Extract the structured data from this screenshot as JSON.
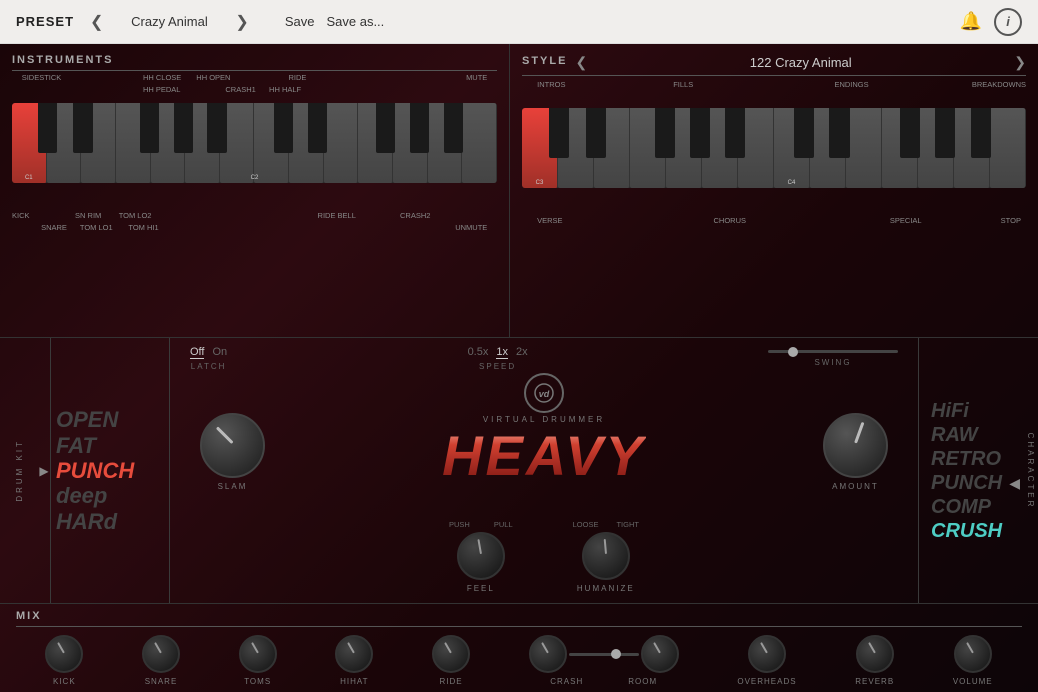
{
  "header": {
    "preset_label": "PRESET",
    "preset_name": "Crazy Animal",
    "save_label": "Save",
    "save_as_label": "Save as...",
    "prev_icon": "❮",
    "next_icon": "❯",
    "bell_icon": "🔔",
    "info_icon": "i"
  },
  "instruments": {
    "title": "INSTRUMENTS",
    "labels_top": [
      "SIDESTICK",
      "HH CLOSE",
      "HH OPEN",
      "RIDE",
      "MUTE"
    ],
    "labels_top2": [
      "",
      "HH PEDAL",
      "",
      "CRASH1",
      "HH HALF"
    ],
    "labels_bottom": [
      "KICK",
      "SN RIM",
      "TOM LO2",
      "RIDE BELL",
      "CRASH2"
    ],
    "labels_bottom2": [
      "",
      "SNARE",
      "TOM LO1",
      "TOM HI1",
      "",
      "UNMUTE"
    ],
    "note_c1": "C1",
    "note_c2": "C2"
  },
  "style": {
    "title": "STYLE",
    "name": "122 Crazy Animal",
    "prev_icon": "❮",
    "next_icon": "❯",
    "labels_top": [
      "INTROS",
      "FILLS",
      "ENDINGS",
      "BREAKDOWNS"
    ],
    "labels_bottom": [
      "VERSE",
      "",
      "CHORUS",
      "",
      "SPECIAL",
      "STOP"
    ],
    "note_c3": "C3",
    "note_c4": "C4"
  },
  "latch": {
    "label": "LATCH",
    "options": [
      "Off",
      "On"
    ]
  },
  "speed": {
    "label": "SPEED",
    "options": [
      "0.5x",
      "1x",
      "2x"
    ]
  },
  "swing": {
    "label": "SWING"
  },
  "virtual_drummer": {
    "subtitle": "VIRTUAL DRUMMER",
    "product": "HEAVY"
  },
  "drum_kit": {
    "label": "DRUM KIT",
    "options": [
      "OPEN",
      "FAT",
      "PUNCH",
      "deep",
      "HARd"
    ],
    "active_index": 2
  },
  "slam": {
    "label": "SLAM"
  },
  "feel": {
    "label": "FEEL",
    "sub_left": "PUSH",
    "sub_right": "PULL"
  },
  "humanize": {
    "label": "HUMANIZE",
    "sub_left": "LOOSE",
    "sub_right": "TIGHT"
  },
  "amount": {
    "label": "AMOUNT"
  },
  "character": {
    "label": "CHARACTER",
    "options": [
      "HiFi",
      "RAW",
      "RETRO",
      "PUNCH",
      "COMP",
      "CRUSH"
    ],
    "active_index": 5
  },
  "mix": {
    "title": "MIX",
    "channels": [
      "KICK",
      "SNARE",
      "TOMS",
      "HIHAT",
      "RIDE",
      "CRASH",
      "ROOM",
      "OVERHEADS",
      "REVERB",
      "VOLUME"
    ]
  }
}
